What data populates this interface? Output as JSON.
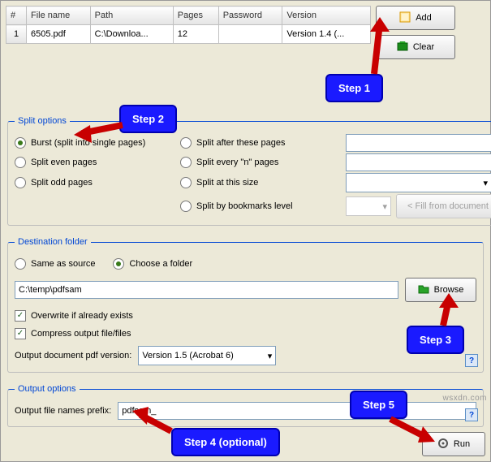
{
  "table": {
    "headers": [
      "#",
      "File name",
      "Path",
      "Pages",
      "Password",
      "Version"
    ],
    "row": {
      "idx": "1",
      "file": "6505.pdf",
      "path": "C:\\Downloa...",
      "pages": "12",
      "password": "",
      "version": "Version 1.4 (..."
    }
  },
  "buttons": {
    "add": "Add",
    "clear": "Clear",
    "browse": "Browse",
    "run": "Run",
    "fill": "< Fill from document"
  },
  "split": {
    "legend": "Split options",
    "burst": "Burst (split into single pages)",
    "even": "Split even pages",
    "odd": "Split odd pages",
    "after": "Split after these pages",
    "every": "Split every \"n\" pages",
    "size": "Split at this size",
    "bookmarks": "Split by bookmarks level"
  },
  "dest": {
    "legend": "Destination folder",
    "same": "Same as source",
    "choose": "Choose a folder",
    "path": "C:\\temp\\pdfsam",
    "overwrite": "Overwrite if already exists",
    "compress": "Compress output file/files",
    "pdfver_label": "Output document pdf version:",
    "pdfver_value": "Version 1.5 (Acrobat 6)"
  },
  "out": {
    "legend": "Output options",
    "prefix_label": "Output file names prefix:",
    "prefix_value": "pdfsam_"
  },
  "steps": {
    "s1": "Step 1",
    "s2": "Step 2",
    "s3": "Step 3",
    "s4": "Step 4 (optional)",
    "s5": "Step 5"
  },
  "help": "?",
  "watermark": "wsxdn.com"
}
